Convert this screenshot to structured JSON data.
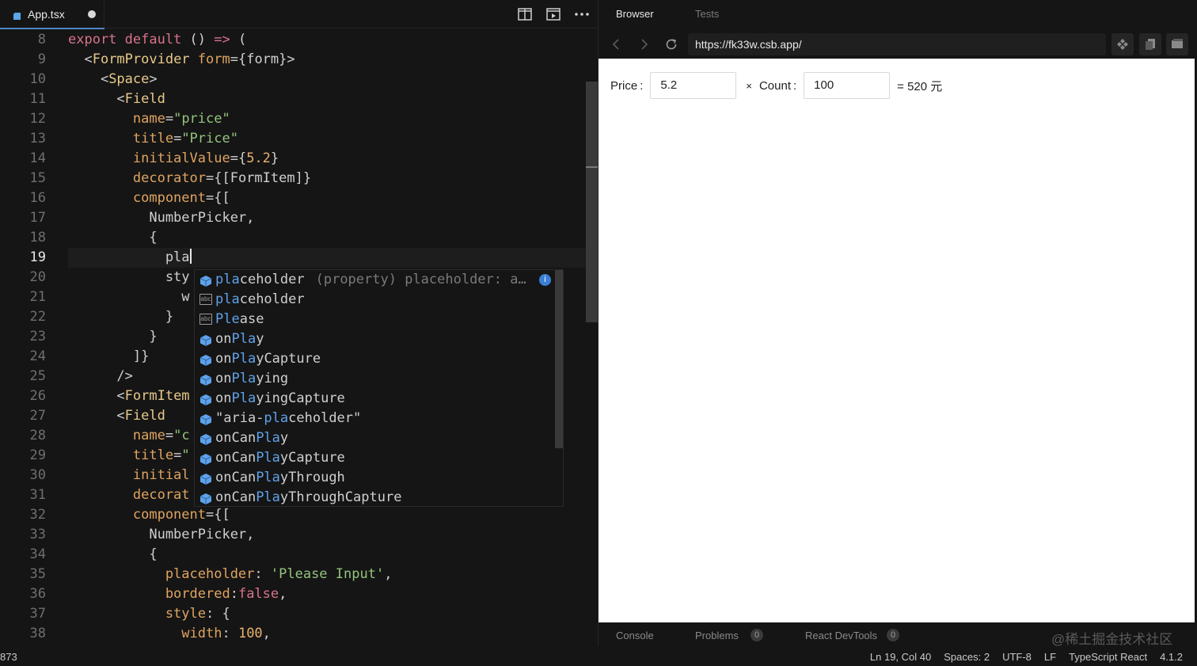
{
  "editor": {
    "tab": {
      "filename": "App.tsx"
    },
    "current_line": 19,
    "lines": [
      {
        "n": "8",
        "tokens": [
          [
            "k",
            "export default"
          ],
          [
            "p",
            " () "
          ],
          [
            "k",
            "=>"
          ],
          [
            "p",
            " ("
          ]
        ]
      },
      {
        "n": "9",
        "tokens": [
          [
            "p",
            "  <"
          ],
          [
            "t",
            "FormProvider"
          ],
          [
            "a",
            " form"
          ],
          [
            "p",
            "={form}>"
          ]
        ]
      },
      {
        "n": "10",
        "tokens": [
          [
            "p",
            "    <"
          ],
          [
            "t",
            "Space"
          ],
          [
            "p",
            ">"
          ]
        ]
      },
      {
        "n": "11",
        "tokens": [
          [
            "p",
            "      <"
          ],
          [
            "t",
            "Field"
          ]
        ]
      },
      {
        "n": "12",
        "tokens": [
          [
            "a",
            "        name"
          ],
          [
            "p",
            "="
          ],
          [
            "s",
            "\"price\""
          ]
        ]
      },
      {
        "n": "13",
        "tokens": [
          [
            "a",
            "        title"
          ],
          [
            "p",
            "="
          ],
          [
            "s",
            "\"Price\""
          ]
        ]
      },
      {
        "n": "14",
        "tokens": [
          [
            "a",
            "        initialValue"
          ],
          [
            "p",
            "={"
          ],
          [
            "n",
            "5.2"
          ],
          [
            "p",
            "}"
          ]
        ]
      },
      {
        "n": "15",
        "tokens": [
          [
            "a",
            "        decorator"
          ],
          [
            "p",
            "={[FormItem]}"
          ]
        ]
      },
      {
        "n": "16",
        "tokens": [
          [
            "a",
            "        component"
          ],
          [
            "p",
            "={["
          ]
        ]
      },
      {
        "n": "17",
        "tokens": [
          [
            "p",
            "          NumberPicker,"
          ]
        ]
      },
      {
        "n": "18",
        "tokens": [
          [
            "p",
            "          {"
          ]
        ]
      },
      {
        "n": "19",
        "tokens": [
          [
            "p",
            "            pla"
          ]
        ]
      },
      {
        "n": "20",
        "tokens": [
          [
            "p",
            "            sty"
          ]
        ]
      },
      {
        "n": "21",
        "tokens": [
          [
            "p",
            "              w"
          ]
        ]
      },
      {
        "n": "22",
        "tokens": [
          [
            "p",
            "            }"
          ]
        ]
      },
      {
        "n": "23",
        "tokens": [
          [
            "p",
            "          }"
          ]
        ]
      },
      {
        "n": "24",
        "tokens": [
          [
            "p",
            "        ]}"
          ]
        ]
      },
      {
        "n": "25",
        "tokens": [
          [
            "p",
            "      />"
          ]
        ]
      },
      {
        "n": "26",
        "tokens": [
          [
            "p",
            "      <"
          ],
          [
            "t",
            "FormItem"
          ]
        ]
      },
      {
        "n": "27",
        "tokens": [
          [
            "p",
            "      <"
          ],
          [
            "t",
            "Field"
          ]
        ]
      },
      {
        "n": "28",
        "tokens": [
          [
            "a",
            "        name"
          ],
          [
            "p",
            "="
          ],
          [
            "s",
            "\"c"
          ]
        ]
      },
      {
        "n": "29",
        "tokens": [
          [
            "a",
            "        title"
          ],
          [
            "p",
            "="
          ],
          [
            "s",
            "\""
          ]
        ]
      },
      {
        "n": "30",
        "tokens": [
          [
            "a",
            "        initial"
          ]
        ]
      },
      {
        "n": "31",
        "tokens": [
          [
            "a",
            "        decorat"
          ]
        ]
      },
      {
        "n": "32",
        "tokens": [
          [
            "a",
            "        component"
          ],
          [
            "p",
            "={["
          ]
        ]
      },
      {
        "n": "33",
        "tokens": [
          [
            "p",
            "          NumberPicker,"
          ]
        ]
      },
      {
        "n": "34",
        "tokens": [
          [
            "p",
            "          {"
          ]
        ]
      },
      {
        "n": "35",
        "tokens": [
          [
            "a",
            "            placeholder"
          ],
          [
            "p",
            ": "
          ],
          [
            "s",
            "'Please Input'"
          ],
          [
            "p",
            ","
          ]
        ]
      },
      {
        "n": "36",
        "tokens": [
          [
            "a",
            "            bordered"
          ],
          [
            "p",
            ":"
          ],
          [
            "k",
            "false"
          ],
          [
            "p",
            ","
          ]
        ]
      },
      {
        "n": "37",
        "tokens": [
          [
            "a",
            "            style"
          ],
          [
            "p",
            ": {"
          ]
        ]
      },
      {
        "n": "38",
        "tokens": [
          [
            "a",
            "              width"
          ],
          [
            "p",
            ": "
          ],
          [
            "n",
            "100"
          ],
          [
            "p",
            ","
          ]
        ]
      }
    ],
    "suggestions": [
      {
        "kind": "property",
        "match": "pla",
        "rest": "ceholder",
        "prefix": "",
        "detail": "(property) placeholder: a…",
        "info": "i"
      },
      {
        "kind": "text",
        "match": "pla",
        "rest": "ceholder",
        "prefix": "",
        "detail": ""
      },
      {
        "kind": "text",
        "match": "Ple",
        "rest": "ase",
        "prefix": "",
        "detail": ""
      },
      {
        "kind": "property",
        "match": "Pla",
        "rest": "y",
        "prefix": "on",
        "detail": ""
      },
      {
        "kind": "property",
        "match": "Pla",
        "rest": "yCapture",
        "prefix": "on",
        "detail": ""
      },
      {
        "kind": "property",
        "match": "Pla",
        "rest": "ying",
        "prefix": "on",
        "detail": ""
      },
      {
        "kind": "property",
        "match": "Pla",
        "rest": "yingCapture",
        "prefix": "on",
        "detail": ""
      },
      {
        "kind": "property",
        "match": "pla",
        "rest": "ceholder\"",
        "prefix": "\"aria-",
        "detail": ""
      },
      {
        "kind": "property",
        "match": "Pla",
        "rest": "y",
        "prefix": "onCan",
        "detail": ""
      },
      {
        "kind": "property",
        "match": "Pla",
        "rest": "yCapture",
        "prefix": "onCan",
        "detail": ""
      },
      {
        "kind": "property",
        "match": "Pla",
        "rest": "yThrough",
        "prefix": "onCan",
        "detail": ""
      },
      {
        "kind": "property",
        "match": "Pla",
        "rest": "yThroughCapture",
        "prefix": "onCan",
        "detail": ""
      }
    ]
  },
  "preview": {
    "tabs": {
      "browser": "Browser",
      "tests": "Tests"
    },
    "url": "https://fk33w.csb.app/",
    "form": {
      "price_label": "Price",
      "price_colon": ":",
      "price_value": "5.2",
      "times": "×",
      "count_label": "Count",
      "count_colon": ":",
      "count_value": "100",
      "result": "= 520 元"
    },
    "bottom_tabs": {
      "console": "Console",
      "problems": "Problems",
      "problems_count": "0",
      "devtools": "React DevTools",
      "devtools_count": "0"
    },
    "watermark": "@稀土掘金技术社区"
  },
  "status": {
    "left": "873",
    "position": "Ln 19, Col 40",
    "spaces": "Spaces: 2",
    "encoding": "UTF-8",
    "eol": "LF",
    "language": "TypeScript React",
    "version": "4.1.2"
  },
  "colors": {
    "accent": "#4f86c6",
    "suggest_match": "#5fa2ea",
    "keyword": "#d8738c",
    "string": "#93c47d",
    "attribute": "#dfa461"
  }
}
